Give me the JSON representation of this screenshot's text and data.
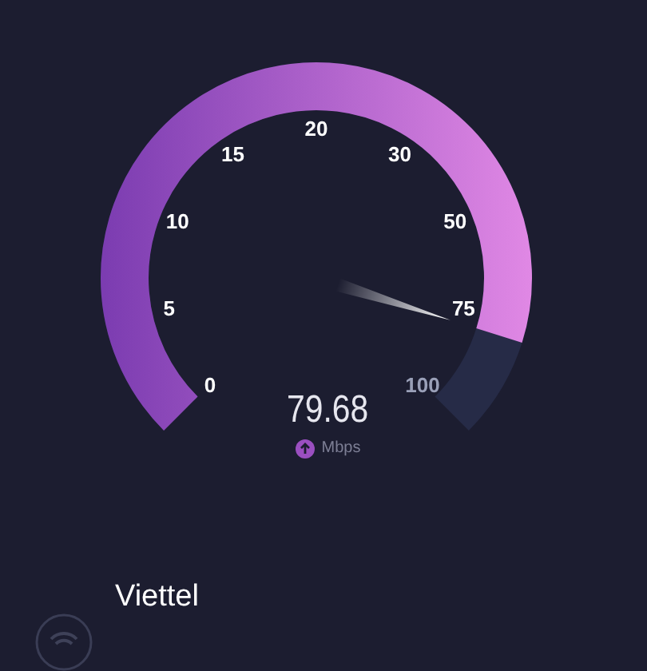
{
  "gauge": {
    "ticks": [
      "0",
      "5",
      "10",
      "15",
      "20",
      "30",
      "50",
      "75",
      "100"
    ]
  },
  "reading": {
    "value": "79.68",
    "unit": "Mbps"
  },
  "network": {
    "name": "Viettel"
  }
}
